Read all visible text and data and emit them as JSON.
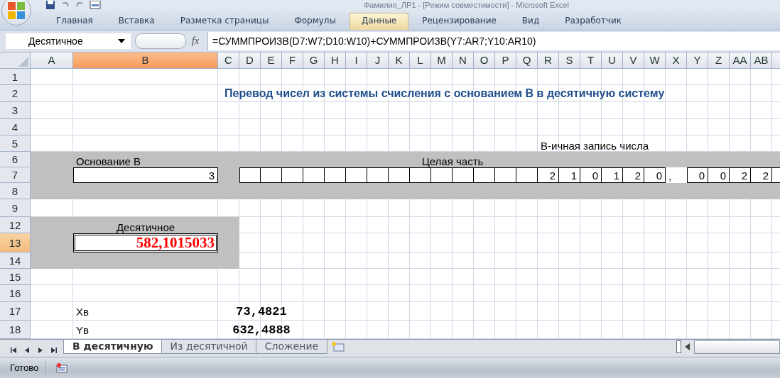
{
  "title": "Фамилия_ЛР1 - [Режим совместимости] - Microsoft Excel",
  "ribbon_tabs": [
    {
      "label": "Главная",
      "selected": false
    },
    {
      "label": "Вставка",
      "selected": false
    },
    {
      "label": "Разметка страницы",
      "selected": false
    },
    {
      "label": "Формулы",
      "selected": false
    },
    {
      "label": "Данные",
      "selected": true
    },
    {
      "label": "Рецензирование",
      "selected": false
    },
    {
      "label": "Вид",
      "selected": false
    },
    {
      "label": "Разработчик",
      "selected": false
    }
  ],
  "name_box": {
    "value": "Десятичное"
  },
  "formula_bar": {
    "function_label": "fx",
    "formula": "=СУММПРОИЗВ(D7:W7;D10:W10)+СУММПРОИЗВ(Y7:AR7;Y10:AR10)"
  },
  "columns": [
    {
      "label": "A",
      "selected": false
    },
    {
      "label": "B",
      "selected": true
    },
    {
      "label": "C",
      "selected": false
    },
    {
      "label": "D",
      "selected": false
    },
    {
      "label": "E",
      "selected": false
    },
    {
      "label": "F",
      "selected": false
    },
    {
      "label": "G",
      "selected": false
    },
    {
      "label": "H",
      "selected": false
    },
    {
      "label": "I",
      "selected": false
    },
    {
      "label": "J",
      "selected": false
    },
    {
      "label": "K",
      "selected": false
    },
    {
      "label": "L",
      "selected": false
    },
    {
      "label": "M",
      "selected": false
    },
    {
      "label": "N",
      "selected": false
    },
    {
      "label": "O",
      "selected": false
    },
    {
      "label": "P",
      "selected": false
    },
    {
      "label": "Q",
      "selected": false
    },
    {
      "label": "R",
      "selected": false
    },
    {
      "label": "S",
      "selected": false
    },
    {
      "label": "T",
      "selected": false
    },
    {
      "label": "U",
      "selected": false
    },
    {
      "label": "V",
      "selected": false
    },
    {
      "label": "W",
      "selected": false
    },
    {
      "label": "X",
      "selected": false
    },
    {
      "label": "Y",
      "selected": false
    },
    {
      "label": "Z",
      "selected": false
    },
    {
      "label": "AA",
      "selected": false
    },
    {
      "label": "AB",
      "selected": false
    }
  ],
  "rows": [
    {
      "label": "1",
      "selected": false
    },
    {
      "label": "2",
      "selected": false
    },
    {
      "label": "3",
      "selected": false
    },
    {
      "label": "4",
      "selected": false
    },
    {
      "label": "5",
      "selected": false
    },
    {
      "label": "6",
      "selected": false
    },
    {
      "label": "7",
      "selected": false
    },
    {
      "label": "8",
      "selected": false
    },
    {
      "label": "9",
      "selected": false
    },
    {
      "label": "12",
      "selected": false
    },
    {
      "label": "13",
      "selected": true
    },
    {
      "label": "14",
      "selected": false
    },
    {
      "label": "15",
      "selected": false
    },
    {
      "label": "16",
      "selected": false
    },
    {
      "label": "17",
      "selected": false
    },
    {
      "label": "18",
      "selected": false
    }
  ],
  "sheet": {
    "heading": "Перевод чисел из системы счисления с основанием В в десятичную систему",
    "notation_label": "В-ичная запись числа",
    "base_label": "Основание В",
    "base_value": "3",
    "integer_part_label": "Целая часть",
    "integer_digits": [
      "2",
      "1",
      "0",
      "1",
      "2",
      "0"
    ],
    "separator": ",",
    "fraction_digits": [
      "0",
      "0",
      "2",
      "2"
    ],
    "decimal_label": "Десятичное",
    "decimal_value": "582,1015033",
    "variables": [
      {
        "name": "Xв",
        "value": "73,4821"
      },
      {
        "name": "Yв",
        "value": "632,4888"
      }
    ]
  },
  "sheet_tabs": [
    {
      "label": "В десятичную",
      "selected": true
    },
    {
      "label": "Из десятичной",
      "selected": false
    },
    {
      "label": "Сложение",
      "selected": false
    }
  ],
  "status_bar": {
    "text": "Готово"
  }
}
